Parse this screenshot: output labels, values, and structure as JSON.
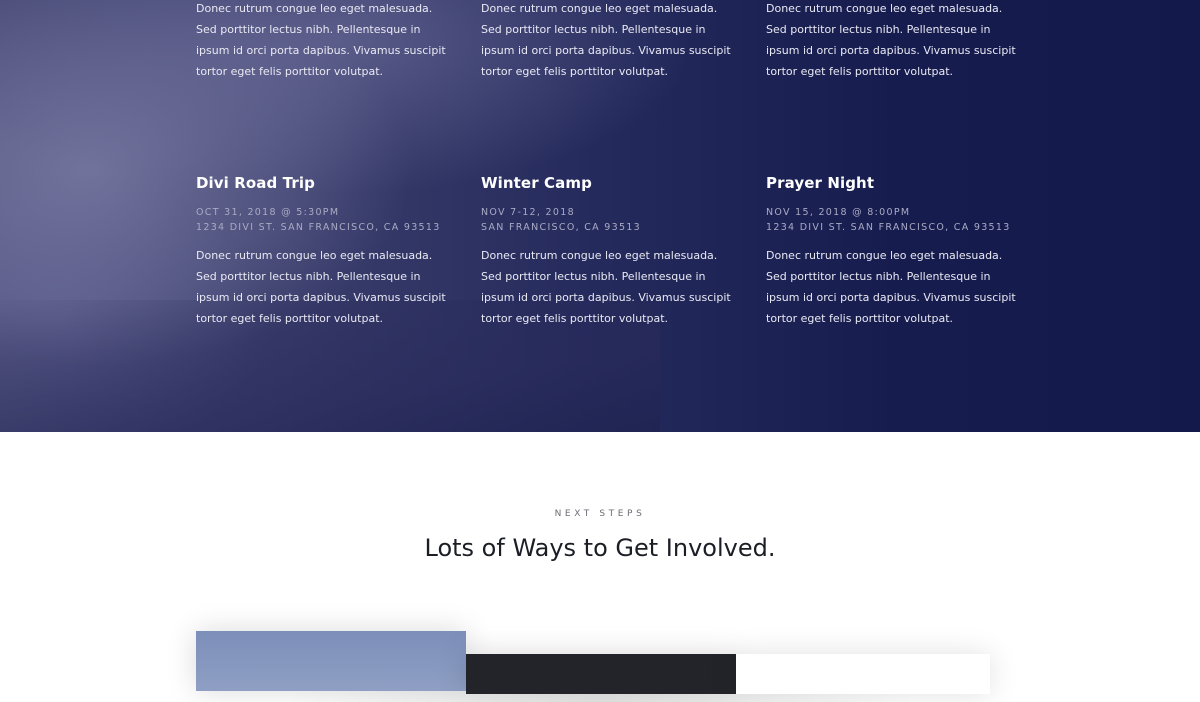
{
  "events_top_row": [
    {
      "description": "Donec rutrum congue leo eget malesuada. Sed porttitor lectus nibh. Pellentesque in ipsum id orci porta dapibus. Vivamus suscipit tortor eget felis porttitor volutpat."
    },
    {
      "description": "Donec rutrum congue leo eget malesuada. Sed porttitor lectus nibh. Pellentesque in ipsum id orci porta dapibus. Vivamus suscipit tortor eget felis porttitor volutpat."
    },
    {
      "description": "Donec rutrum congue leo eget malesuada. Sed porttitor lectus nibh. Pellentesque in ipsum id orci porta dapibus. Vivamus suscipit tortor eget felis porttitor volutpat."
    }
  ],
  "events": [
    {
      "title": "Divi Road Trip",
      "date": "OCT 31, 2018 @ 5:30PM",
      "address": "1234 DIVI ST. SAN FRANCISCO, CA 93513",
      "description": "Donec rutrum congue leo eget malesuada. Sed porttitor lectus nibh. Pellentesque in ipsum id orci porta dapibus. Vivamus suscipit tortor eget felis porttitor volutpat."
    },
    {
      "title": "Winter Camp",
      "date": "NOV 7-12, 2018",
      "address": "SAN FRANCISCO, CA 93513",
      "description": "Donec rutrum congue leo eget malesuada. Sed porttitor lectus nibh. Pellentesque in ipsum id orci porta dapibus. Vivamus suscipit tortor eget felis porttitor volutpat."
    },
    {
      "title": "Prayer Night",
      "date": "NOV 15, 2018 @ 8:00PM",
      "address": "1234 DIVI ST. SAN FRANCISCO, CA 93513",
      "description": "Donec rutrum congue leo eget malesuada. Sed porttitor lectus nibh. Pellentesque in ipsum id orci porta dapibus. Vivamus suscipit tortor eget felis porttitor volutpat."
    }
  ],
  "next_steps": {
    "eyebrow": "NEXT STEPS",
    "heading": "Lots of Ways to Get Involved."
  },
  "colors": {
    "hero_dark": "#131a4b",
    "card_dark": "#232429",
    "card_blue": "#8f9fc4"
  }
}
